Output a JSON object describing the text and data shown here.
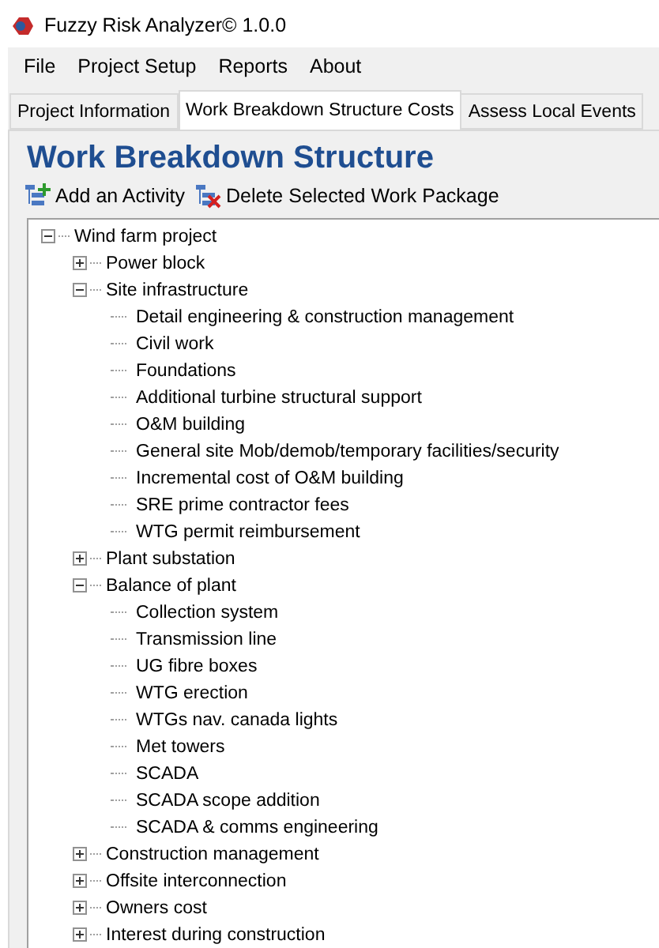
{
  "window": {
    "title": "Fuzzy Risk Analyzer© 1.0.0"
  },
  "menu": [
    "File",
    "Project Setup",
    "Reports",
    "About"
  ],
  "tabs": [
    {
      "label": "Project Information",
      "selected": false
    },
    {
      "label": "Work Breakdown Structure Costs",
      "selected": true
    },
    {
      "label": "Assess Local Events",
      "selected": false
    }
  ],
  "group": {
    "title": "Work Breakdown Structure"
  },
  "toolbar": [
    {
      "label": "Add an Activity",
      "kind": "add"
    },
    {
      "label": "Delete Selected Work Package",
      "kind": "delete"
    }
  ],
  "tree": [
    {
      "label": "Wind farm project",
      "expanded": true,
      "children": [
        {
          "label": "Power block",
          "expanded": false
        },
        {
          "label": "Site infrastructure",
          "expanded": true,
          "children": [
            {
              "label": "Detail engineering & construction management"
            },
            {
              "label": "Civil work"
            },
            {
              "label": "Foundations"
            },
            {
              "label": "Additional turbine structural support"
            },
            {
              "label": "O&M building"
            },
            {
              "label": "General site Mob/demob/temporary facilities/security"
            },
            {
              "label": "Incremental cost of O&M building"
            },
            {
              "label": "SRE prime contractor fees"
            },
            {
              "label": "WTG permit reimbursement"
            }
          ]
        },
        {
          "label": "Plant substation",
          "expanded": false
        },
        {
          "label": "Balance of plant",
          "expanded": true,
          "children": [
            {
              "label": "Collection system"
            },
            {
              "label": "Transmission line"
            },
            {
              "label": "UG fibre boxes"
            },
            {
              "label": "WTG erection"
            },
            {
              "label": "WTGs nav. canada lights"
            },
            {
              "label": "Met towers"
            },
            {
              "label": "SCADA"
            },
            {
              "label": "SCADA scope addition"
            },
            {
              "label": "SCADA & comms engineering"
            }
          ]
        },
        {
          "label": "Construction management",
          "expanded": false
        },
        {
          "label": "Offsite interconnection",
          "expanded": false
        },
        {
          "label": "Owners cost",
          "expanded": false
        },
        {
          "label": "Interest during construction",
          "expanded": false
        }
      ]
    }
  ]
}
